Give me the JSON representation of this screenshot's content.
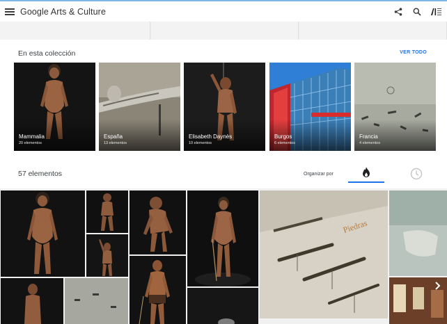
{
  "header": {
    "brand": "Google Arts & Culture",
    "icons": [
      "menu-icon",
      "share-icon",
      "search-icon",
      "museum-logo-icon"
    ]
  },
  "collection": {
    "title": "En esta colección",
    "see_all": "VER TODO",
    "cards": [
      {
        "name": "Mammalia",
        "count": "20 elementos"
      },
      {
        "name": "España",
        "count": "13 elementos"
      },
      {
        "name": "Elisabeth Daynès",
        "count": "10 elementos"
      },
      {
        "name": "Burgos",
        "count": "6 elementos"
      },
      {
        "name": "Francia",
        "count": "4 elementos"
      }
    ]
  },
  "results": {
    "count": "57 elementos",
    "sort_label": "Organizar por",
    "sort_options": [
      "popularity-icon",
      "clock-icon"
    ]
  },
  "colors": {
    "accent": "#1a73e8",
    "topbar_border": "#7fb6e6"
  }
}
